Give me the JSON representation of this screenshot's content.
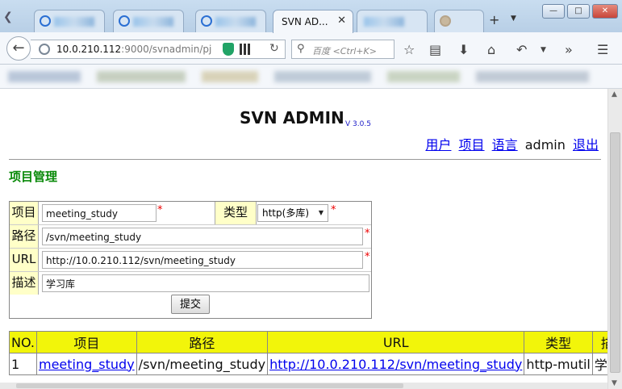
{
  "browser": {
    "active_tab_title": "SVN AD...",
    "url_host": "10.0.210.112",
    "url_rest": ":9000/svnadmin/pj",
    "search_placeholder": "百度 <Ctrl+K>",
    "icons": {
      "back": "back-arrow-icon",
      "reload": "reload-icon",
      "search": "search-icon",
      "bookmark_star": "star-icon",
      "reading_list": "reading-list-icon",
      "downloads": "download-icon",
      "home": "home-icon",
      "undo": "undo-icon",
      "overflow": "overflow-icon",
      "menu": "hamburger-menu-icon"
    }
  },
  "header": {
    "title": "SVN ADMIN",
    "version": "V 3.0.5"
  },
  "topnav": {
    "users": "用户",
    "projects": "项目",
    "language": "语言",
    "username": "admin",
    "logout": "退出"
  },
  "section_title": "项目管理",
  "form": {
    "project_label": "项目",
    "project_value": "meeting_study",
    "type_label": "类型",
    "type_value": "http(多库)",
    "path_label": "路径",
    "path_value": "/svn/meeting_study",
    "url_label": "URL",
    "url_value": "http://10.0.210.112/svn/meeting_study",
    "desc_label": "描述",
    "desc_value": "学习库",
    "required_mark": "*",
    "submit_label": "提交"
  },
  "table": {
    "headers": [
      "NO.",
      "项目",
      "路径",
      "URL",
      "类型",
      "描述"
    ],
    "rows": [
      {
        "no": "1",
        "project": "meeting_study",
        "path": "/svn/meeting_study",
        "url": "http://10.0.210.112/svn/meeting_study",
        "type": "http-mutil",
        "desc": "学习库"
      }
    ]
  },
  "colors": {
    "accent_green": "#0a8a0a",
    "label_bg": "#ffffc8",
    "header_yellow": "#f2f50a",
    "link_blue": "#0000ee",
    "required_red": "#e00000"
  }
}
